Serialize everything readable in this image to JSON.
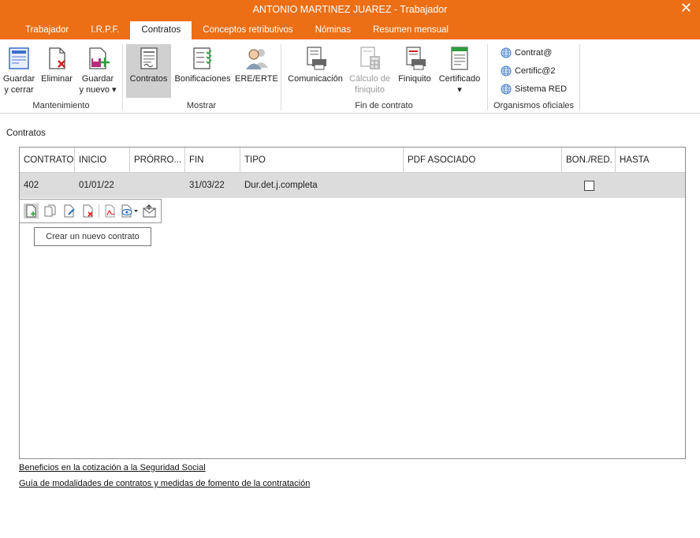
{
  "window": {
    "title": "ANTONIO MARTINEZ JUAREZ - Trabajador",
    "close_glyph": "✕"
  },
  "tabs": [
    "Trabajador",
    "I.R.P.F.",
    "Contratos",
    "Conceptos retributivos",
    "Nóminas",
    "Resumen mensual"
  ],
  "active_tab": "Contratos",
  "ribbon": {
    "mantenimiento": {
      "label": "Mantenimiento",
      "guardar_cerrar": [
        "Guardar",
        "y cerrar"
      ],
      "eliminar": "Eliminar",
      "guardar_nuevo": [
        "Guardar",
        "y nuevo ▾"
      ]
    },
    "mostrar": {
      "label": "Mostrar",
      "contratos": "Contratos",
      "bonificaciones": "Bonificaciones",
      "ere_erte": "ERE/ERTE"
    },
    "fin_contrato": {
      "label": "Fin de contrato",
      "comunicacion": "Comunicación",
      "calculo_finiquito": [
        "Cálculo de",
        "finiquito"
      ],
      "finiquito": "Finiquito",
      "certificado": "Certificado",
      "certificado_arrow": "▾"
    },
    "organismos": {
      "label": "Organismos oficiales",
      "items": [
        "Contrat@",
        "Certific@2",
        "Sistema RED"
      ]
    }
  },
  "section_label": "Contratos",
  "table": {
    "columns": [
      "CONTRATO",
      "INICIO",
      "PRÓRRO...",
      "FIN",
      "TIPO",
      "PDF ASOCIADO",
      "BON./RED.",
      "HASTA"
    ],
    "rows": [
      {
        "contrato": "402",
        "inicio": "01/01/22",
        "prorroga": "",
        "fin": "31/03/22",
        "tipo": "Dur.det.j.completa",
        "pdf": "",
        "bon_red": false,
        "hasta": ""
      }
    ]
  },
  "row_tools": {
    "icons": [
      "new-contract-icon",
      "copy-contract-icon",
      "edit-contract-icon",
      "delete-contract-icon",
      "pdf-icon",
      "view-dropdown-icon",
      "export-icon"
    ]
  },
  "tooltip": "Crear un nuevo contrato",
  "links": [
    "Beneficios en la cotización a la Seguridad Social",
    "Guía de modalidades de contratos y medidas de fomento de la contratación"
  ],
  "colors": {
    "accent": "#ec6f16",
    "selected_row": "#dcdcdc",
    "selected_button": "#d0d0d0"
  }
}
